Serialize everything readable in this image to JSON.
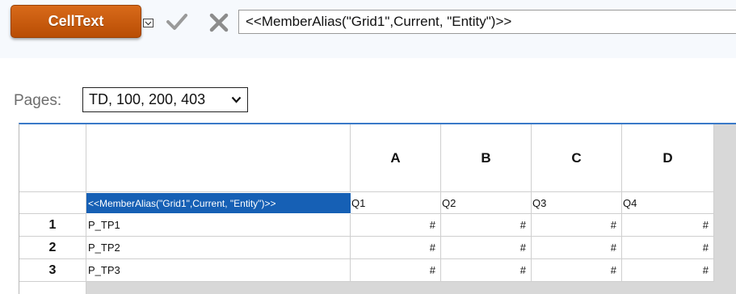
{
  "toolbar": {
    "celltext_label": "CellText",
    "formula_value": "<<MemberAlias(\"Grid1\",Current, \"Entity\")>>"
  },
  "pages": {
    "label": "Pages:",
    "selected": "TD, 100, 200, 403"
  },
  "grid": {
    "columns": [
      "A",
      "B",
      "C",
      "D"
    ],
    "header_row": {
      "selected_cell": "<<MemberAlias(\"Grid1\",Current, \"Entity\")>>",
      "periods": [
        "Q1",
        "Q2",
        "Q3",
        "Q4"
      ]
    },
    "rows": [
      {
        "num": "1",
        "member": "P_TP1",
        "values": [
          "#",
          "#",
          "#",
          "#"
        ]
      },
      {
        "num": "2",
        "member": "P_TP2",
        "values": [
          "#",
          "#",
          "#",
          "#"
        ]
      },
      {
        "num": "3",
        "member": "P_TP3",
        "values": [
          "#",
          "#",
          "#",
          "#"
        ]
      }
    ]
  },
  "colors": {
    "button": "#c85a0f",
    "selection": "#1660b5",
    "grid_accent": "#3a7ac8"
  }
}
